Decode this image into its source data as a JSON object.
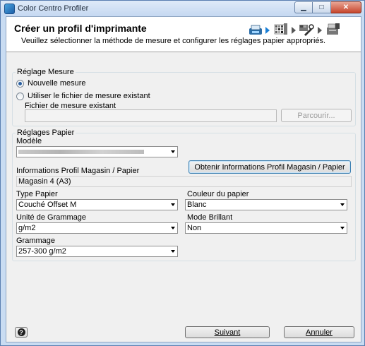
{
  "window": {
    "title": "Color Centro Profiler"
  },
  "header": {
    "title": "Créer un profil d'imprimante",
    "subtitle": "Veuillez sélectionner la méthode de mesure et configurer les réglages papier appropriés."
  },
  "steps": {
    "icons": [
      "printer-icon",
      "color-chart-icon",
      "wrench-icon",
      "printer-profile-icon"
    ]
  },
  "measure": {
    "group_label": "Réglage Mesure",
    "option_new": "Nouvelle mesure",
    "option_existing": "Utiliser le fichier de mesure existant",
    "selected": "Nouvelle mesure",
    "file_label": "Fichier de mesure existant",
    "file_value": "",
    "browse_label": "Parcourir..."
  },
  "paper": {
    "group_label": "Réglages Papier",
    "model_label": "Modèle",
    "model_value": "",
    "info_label": "Informations Profil Magasin / Papier",
    "get_info_button": "Obtenir Informations Profil Magasin / Papier",
    "info_value": "Magasin 4 (A3)",
    "type_label": "Type Papier",
    "type_value": "Couché Offset M",
    "color_label": "Couleur du papier",
    "color_value": "Blanc",
    "weight_unit_label": "Unité de Grammage",
    "weight_unit_value": "g/m2",
    "gloss_label": "Mode Brillant",
    "gloss_value": "Non",
    "weight_label": "Grammage",
    "weight_value": "257-300 g/m2"
  },
  "footer": {
    "help_label": "?",
    "next_label": "Suivant",
    "cancel_label": "Annuler"
  }
}
